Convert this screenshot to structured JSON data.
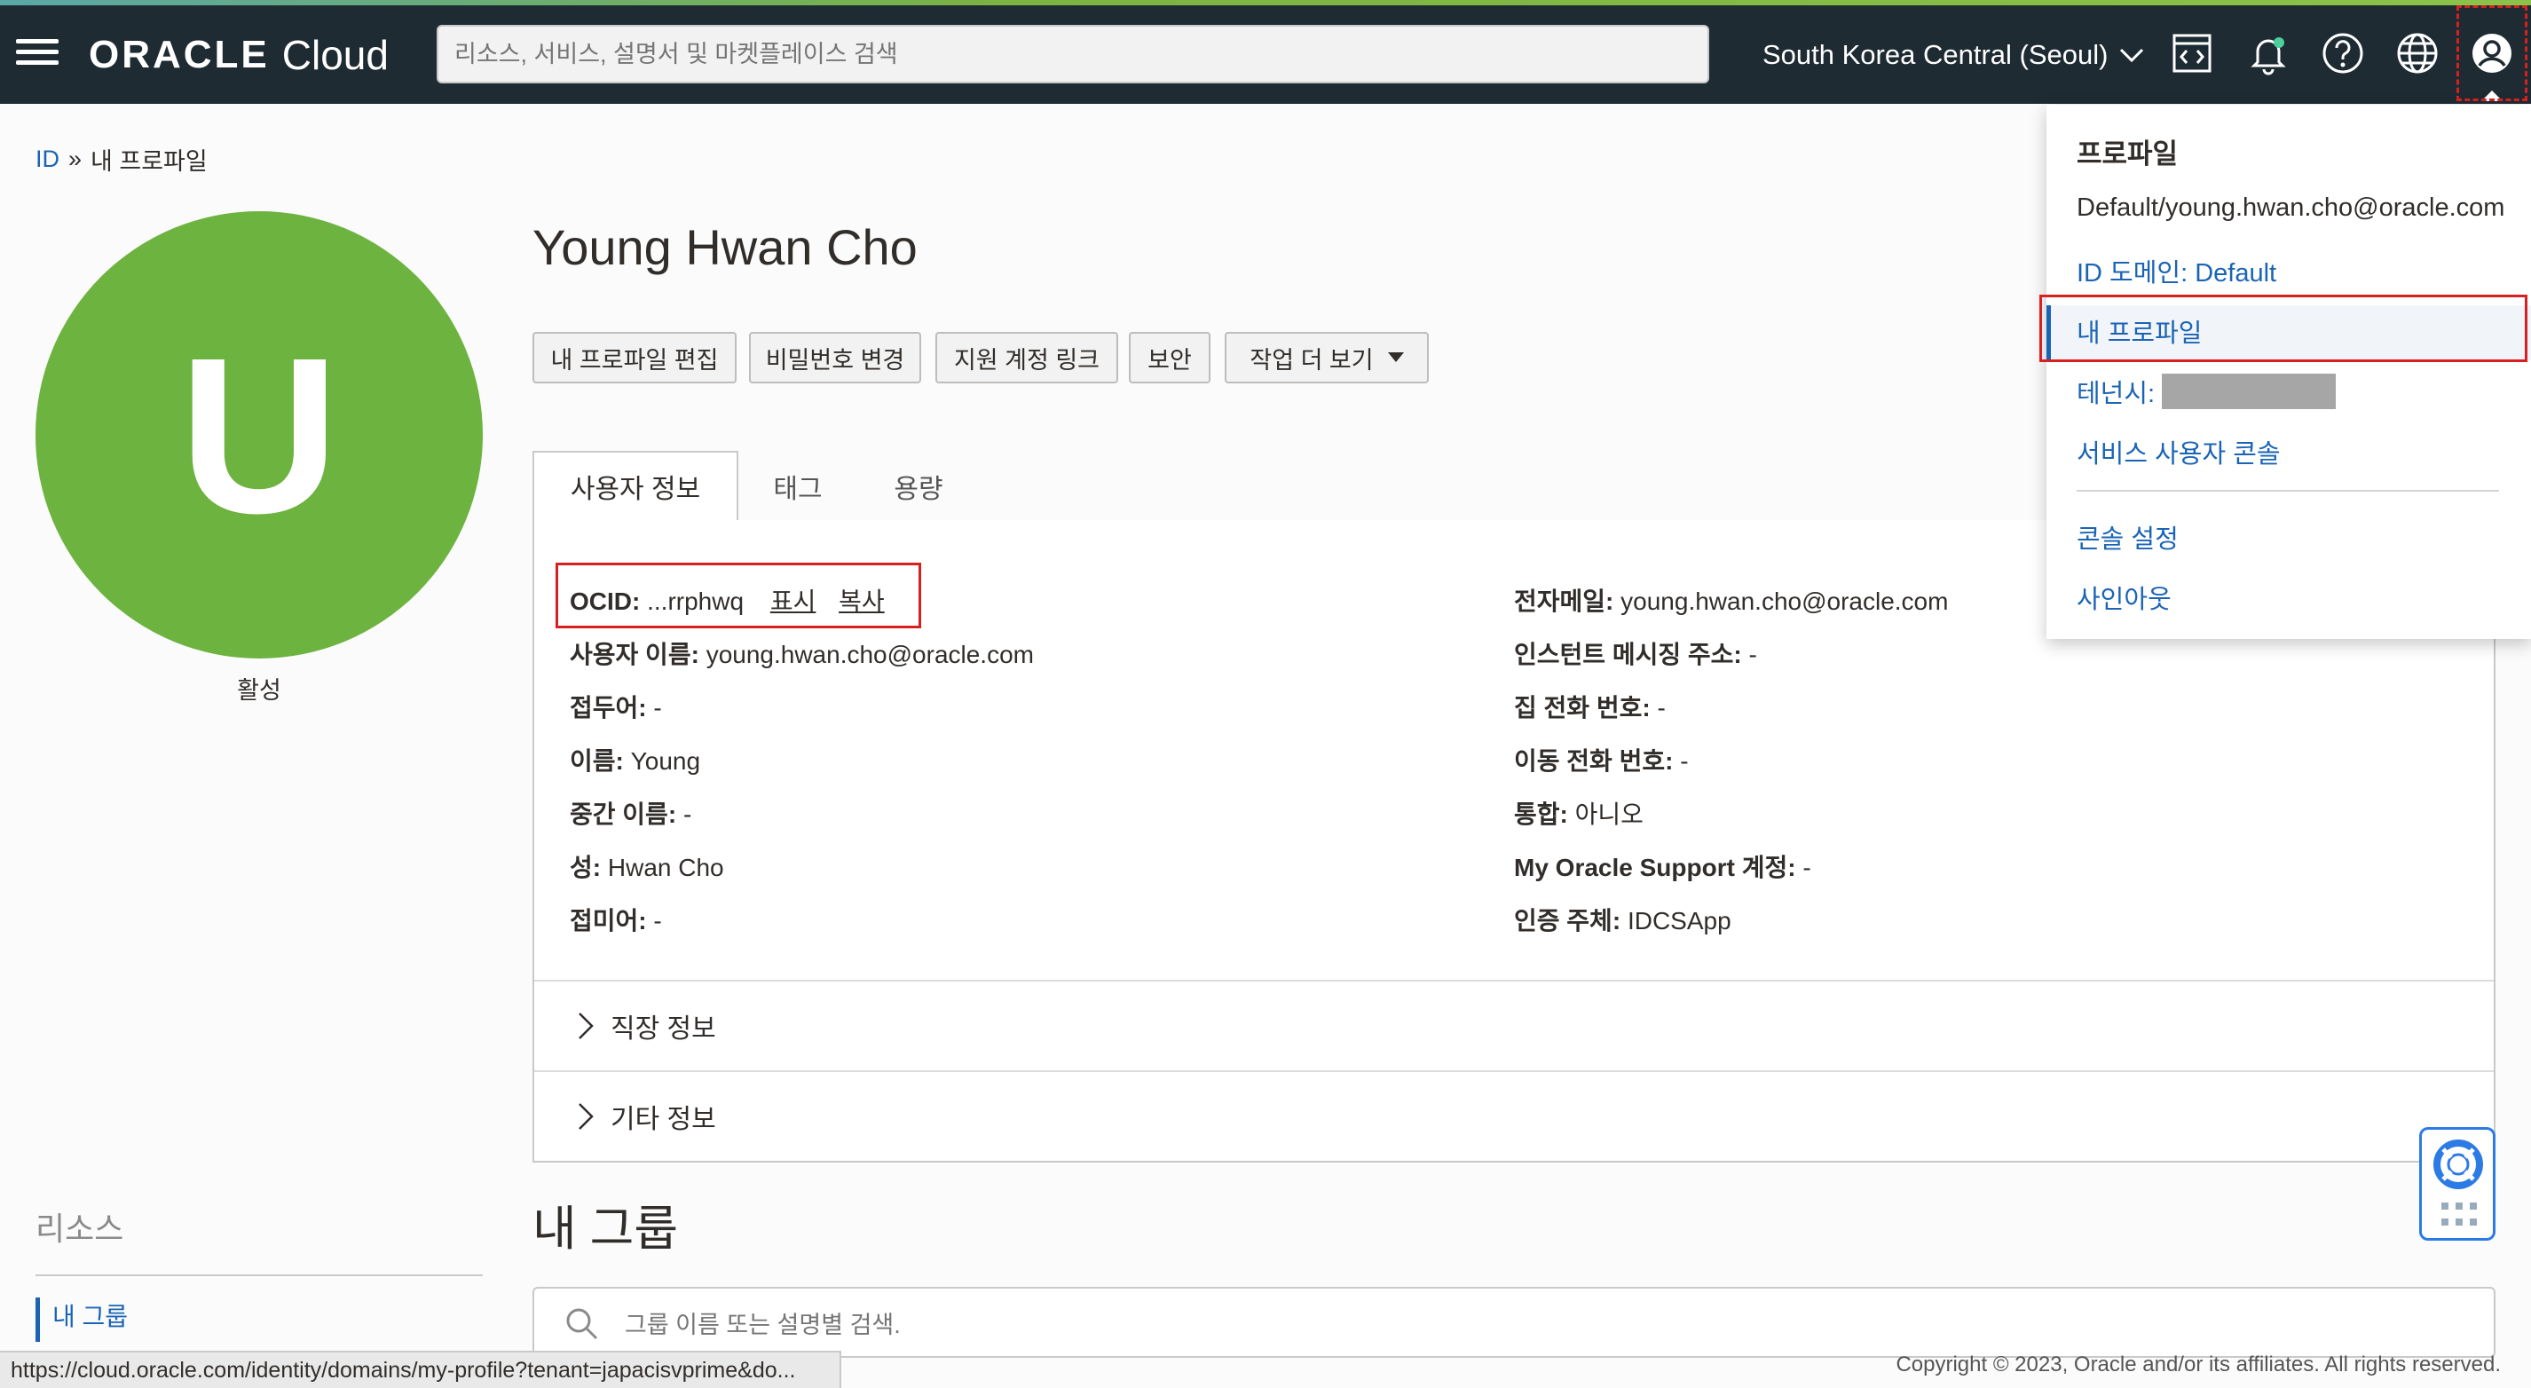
{
  "header": {
    "logo_oracle": "ORACLE",
    "logo_cloud": "Cloud",
    "search_placeholder": "리소스, 서비스, 설명서 및 마켓플레이스 검색",
    "region": "South Korea Central (Seoul)"
  },
  "breadcrumb": {
    "root": "ID",
    "separator": "»",
    "current": "내 프로파일"
  },
  "user": {
    "avatar_letter": "U",
    "status": "활성",
    "name": "Young Hwan Cho"
  },
  "actions": {
    "edit": "내 프로파일 편집",
    "password": "비밀번호 변경",
    "link_account": "지원 계정 링크",
    "security": "보안",
    "more": "작업 더 보기"
  },
  "tabs": [
    "사용자 정보",
    "태그",
    "용량"
  ],
  "info_left": [
    {
      "label": "OCID:",
      "value": "...rrphwq"
    },
    {
      "label": "사용자 이름:",
      "value": "young.hwan.cho@oracle.com"
    },
    {
      "label": "접두어:",
      "value": "-"
    },
    {
      "label": "이름:",
      "value": "Young"
    },
    {
      "label": "중간 이름:",
      "value": "-"
    },
    {
      "label": "성:",
      "value": "Hwan Cho"
    },
    {
      "label": "접미어:",
      "value": "-"
    }
  ],
  "ocid_links": {
    "show": "표시",
    "copy": "복사"
  },
  "info_right": [
    {
      "label": "전자메일:",
      "value": "young.hwan.cho@oracle.com"
    },
    {
      "label": "인스턴트 메시징 주소:",
      "value": "-"
    },
    {
      "label": "집 전화 번호:",
      "value": "-"
    },
    {
      "label": "이동 전화 번호:",
      "value": "-"
    },
    {
      "label": "통합:",
      "value": "아니오"
    },
    {
      "label": "My Oracle Support 계정:",
      "value": "-"
    },
    {
      "label": "인증 주체:",
      "value": "IDCSApp"
    }
  ],
  "sections": {
    "job": "직장 정보",
    "other": "기타 정보"
  },
  "groups": {
    "title": "내 그룹",
    "search_placeholder": "그룹 이름 또는 설명별 검색."
  },
  "resources": {
    "title": "리소스",
    "item": "내 그룹"
  },
  "dropdown": {
    "heading": "프로파일",
    "account": "Default/young.hwan.cho@oracle.com",
    "domain": "ID 도메인: Default",
    "my_profile": "내 프로파일",
    "tenancy_label": "테넌시:",
    "service_console": "서비스 사용자 콘솔",
    "console_settings": "콘솔 설정",
    "sign_out": "사인아웃"
  },
  "statusbar": "https://cloud.oracle.com/identity/domains/my-profile?tenant=japacisvprime&do...",
  "copyright": "Copyright © 2023, Oracle and/or its affiliates. All rights reserved.",
  "colors": {
    "accent_green": "#6db33f",
    "topbar": "#1e2b33",
    "link_blue": "#1a64b5",
    "highlight_red": "#d92020"
  }
}
